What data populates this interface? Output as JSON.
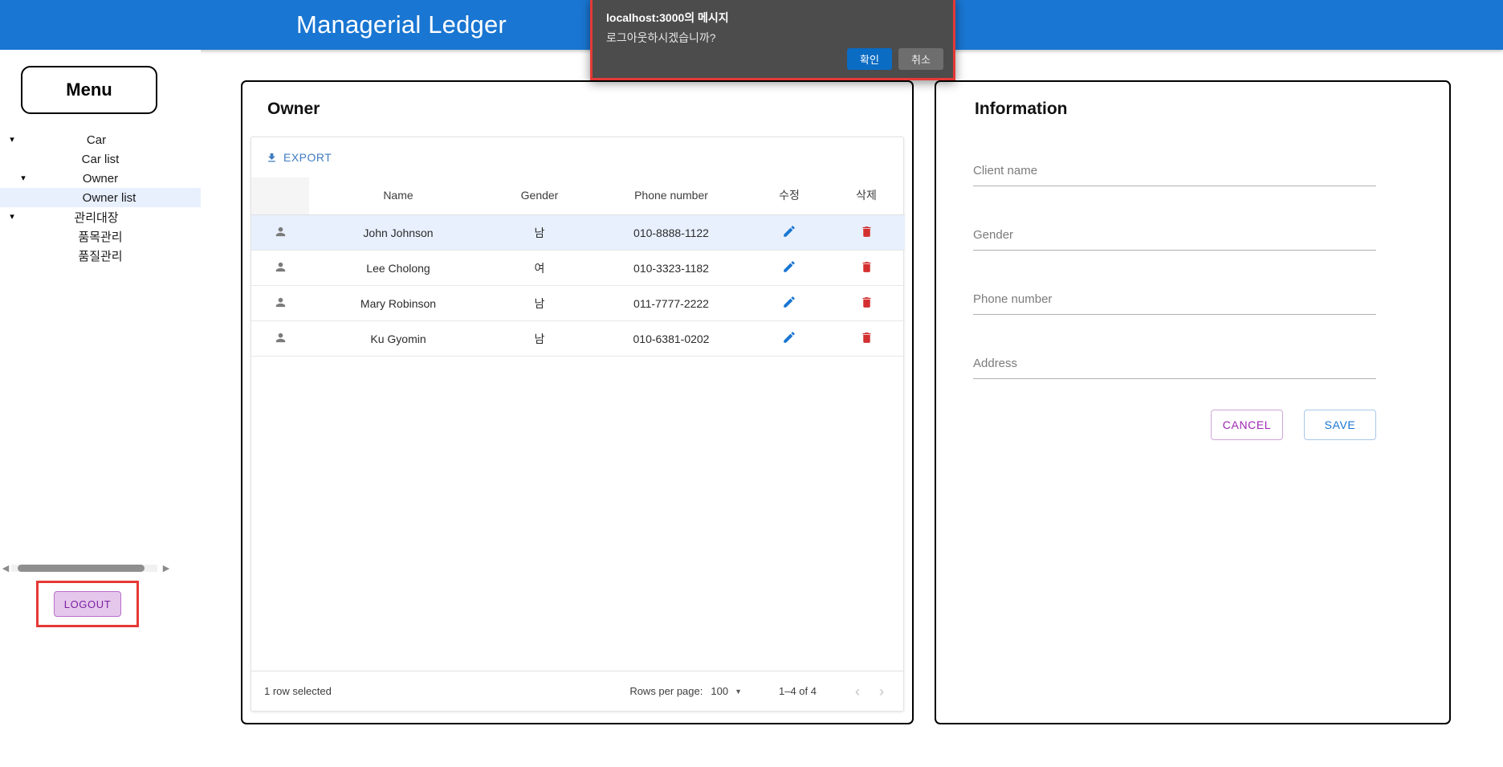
{
  "app": {
    "title": "Managerial Ledger",
    "accent_color": "#1976d2"
  },
  "sidebar": {
    "menu_label": "Menu",
    "tree": [
      {
        "label": "Car",
        "level": 1,
        "caret": true,
        "selected": false
      },
      {
        "label": "Car list",
        "level": 2,
        "caret": false,
        "selected": false
      },
      {
        "label": "Owner",
        "level": 2,
        "caret": true,
        "selected": false
      },
      {
        "label": "Owner list",
        "level": 3,
        "caret": false,
        "selected": true
      },
      {
        "label": "관리대장",
        "level": 1,
        "caret": true,
        "selected": false
      },
      {
        "label": "품목관리",
        "level": 2,
        "caret": false,
        "selected": false
      },
      {
        "label": "품질관리",
        "level": 2,
        "caret": false,
        "selected": false
      }
    ],
    "logout_label": "LOGOUT",
    "scroll_left_arrow": "◀",
    "scroll_right_arrow": "▶"
  },
  "owner_panel": {
    "title": "Owner",
    "export_label": "EXPORT",
    "columns": [
      "",
      "Name",
      "Gender",
      "Phone number",
      "수정",
      "삭제"
    ],
    "rows": [
      {
        "name": "John Johnson",
        "gender": "남",
        "phone": "010-8888-1122",
        "selected": true
      },
      {
        "name": "Lee Cholong",
        "gender": "여",
        "phone": "010-3323-1182",
        "selected": false
      },
      {
        "name": "Mary Robinson",
        "gender": "남",
        "phone": "011-7777-2222",
        "selected": false
      },
      {
        "name": "Ku Gyomin",
        "gender": "남",
        "phone": "010-6381-0202",
        "selected": false
      }
    ],
    "footer": {
      "selection_text": "1 row selected",
      "rows_per_page_label": "Rows per page:",
      "rows_per_page_value": "100",
      "range_text": "1–4 of 4",
      "prev_glyph": "‹",
      "next_glyph": "›"
    },
    "edit_icon_color": "#1976d2",
    "delete_icon_color": "#d32f2f"
  },
  "info_panel": {
    "title": "Information",
    "fields": [
      {
        "placeholder": "Client name",
        "value": ""
      },
      {
        "placeholder": "Gender",
        "value": ""
      },
      {
        "placeholder": "Phone number",
        "value": ""
      },
      {
        "placeholder": "Address",
        "value": ""
      }
    ],
    "cancel_label": "CANCEL",
    "save_label": "SAVE",
    "cancel_color": "#9c27b0",
    "save_color": "#1976d2"
  },
  "dialog": {
    "title": "localhost:3000의 메시지",
    "message": "로그아웃하시겠습니까?",
    "ok_label": "확인",
    "cancel_label": "취소"
  }
}
